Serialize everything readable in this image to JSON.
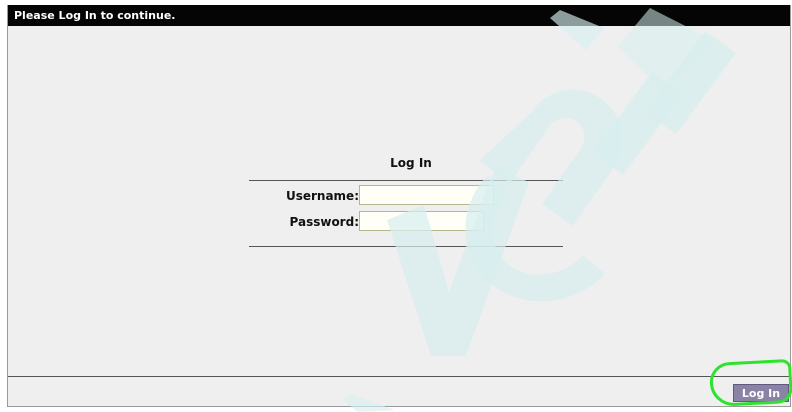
{
  "window": {
    "title": "Please Log In to continue."
  },
  "login": {
    "heading": "Log In",
    "username_label": "Username:",
    "username_value": "",
    "password_label": "Password:",
    "password_value": ""
  },
  "footer": {
    "login_button_label": "Log In"
  },
  "colors": {
    "titlebar": "#050505",
    "background": "#efefef",
    "button": "#8a83a6",
    "highlight": "#2ee32e",
    "watermark": "#d7eeee"
  }
}
